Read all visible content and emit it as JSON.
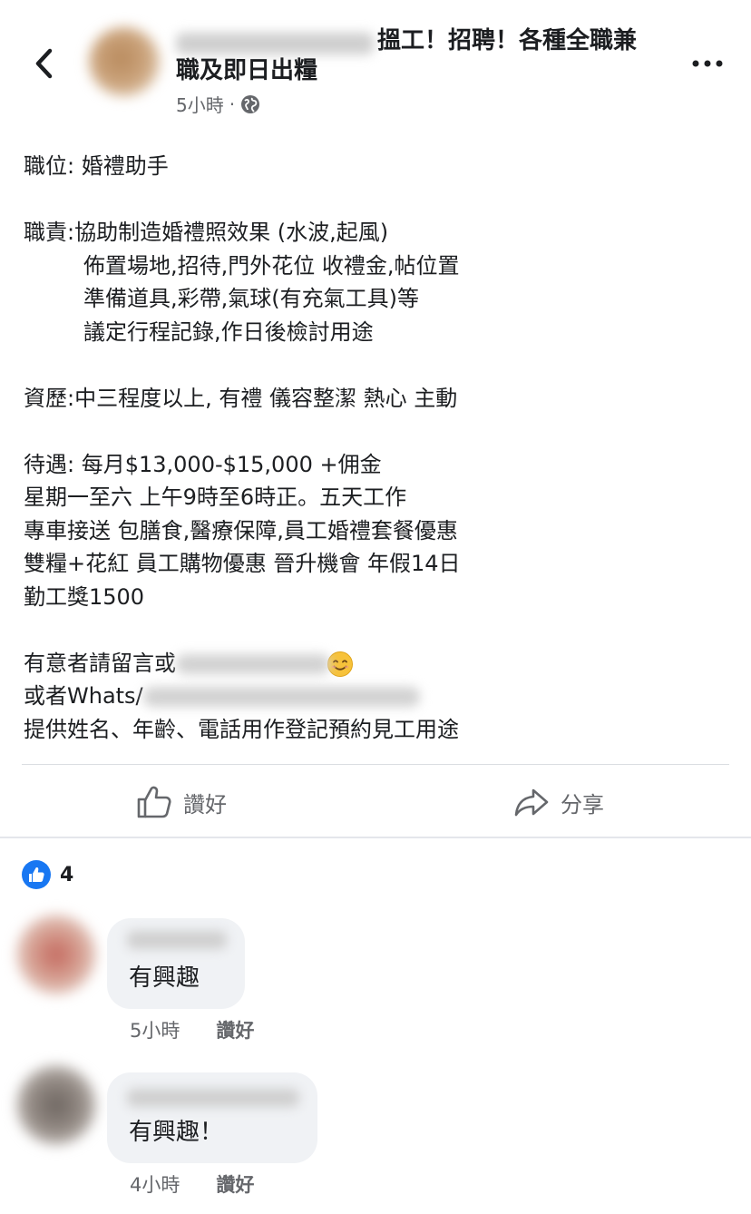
{
  "header": {
    "title_part1": "搵工！招聘！各種全職兼",
    "title_part2": "職及即日出糧",
    "time": "5小時",
    "separator": "·",
    "audience_icon": "globe-icon",
    "back_icon": "chevron-left-icon",
    "more_icon": "more-horizontal-icon"
  },
  "post": {
    "position": "職位: 婚禮助手",
    "duties_title": "職責:協助制造婚禮照效果 (水波,起風)",
    "duty_2": "佈置場地,招待,門外花位 收禮金,帖位置",
    "duty_3": "準備道具,彩帶,氣球(有充氣工具)等",
    "duty_4": "議定行程記錄,作日後檢討用途",
    "qualification": "資歷:中三程度以上, 有禮 儀容整潔 熱心 主動",
    "pay": "待遇: 每月$13,000-$15,000 +佣金",
    "hours": "星期一至六 上午9時至6時正。五天工作",
    "benefits_1": "專車接送 包膳食,醫療保障,員工婚禮套餐優惠",
    "benefits_2": "雙糧+花紅 員工購物優惠 晉升機會 年假14日",
    "benefits_3": "勤工獎1500",
    "contact_1": "有意者請留言或",
    "contact_2": "或者Whats/",
    "contact_3": "提供姓名、年齡、電話用作登記預約見工用途"
  },
  "actions": {
    "like_label": "讚好",
    "share_label": "分享"
  },
  "reactions": {
    "count": "4"
  },
  "comments": [
    {
      "text": "有興趣",
      "time": "5小時",
      "like_label": "讚好"
    },
    {
      "text": "有興趣！",
      "time": "4小時",
      "like_label": "讚好"
    }
  ],
  "colors": {
    "text": "#1c1e21",
    "secondary": "#65676b",
    "accent": "#1877f2",
    "bubble": "#f0f2f5",
    "smiley": "#f7c23a"
  }
}
